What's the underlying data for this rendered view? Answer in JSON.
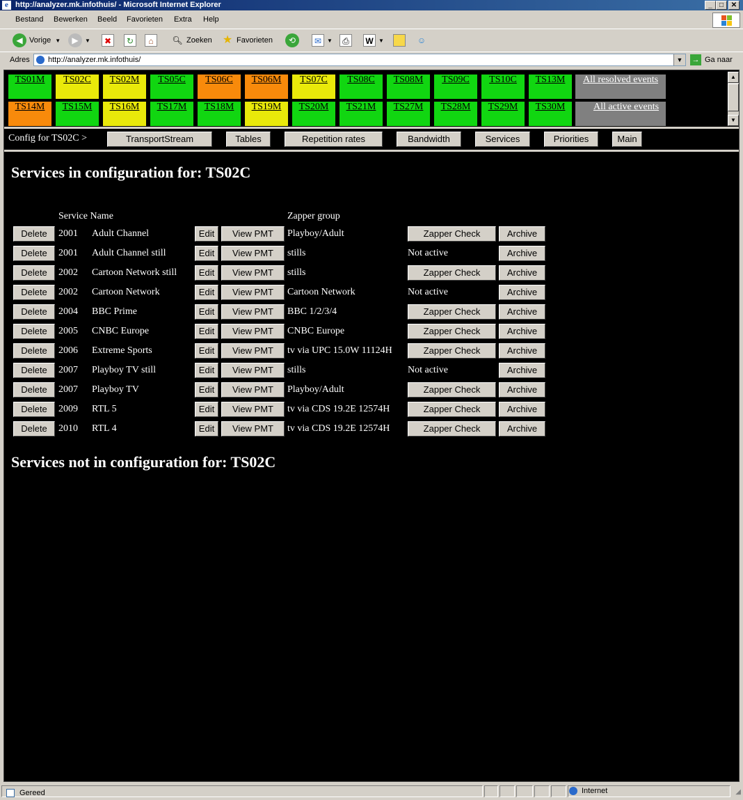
{
  "window": {
    "title": "http://analyzer.mk.infothuis/ - Microsoft Internet Explorer"
  },
  "menu": [
    "Bestand",
    "Bewerken",
    "Beeld",
    "Favorieten",
    "Extra",
    "Help"
  ],
  "toolbar": {
    "back": "Vorige",
    "search": "Zoeken",
    "favorites": "Favorieten"
  },
  "address": {
    "label": "Adres",
    "url": "http://analyzer.mk.infothuis/",
    "go": "Ga naar"
  },
  "ts_rows": [
    [
      {
        "label": "TS01M",
        "status": "green"
      },
      {
        "label": "TS02C",
        "status": "yellow"
      },
      {
        "label": "TS02M",
        "status": "yellow"
      },
      {
        "label": "TS05C",
        "status": "green"
      },
      {
        "label": "TS06C",
        "status": "orange"
      },
      {
        "label": "TS06M",
        "status": "orange"
      },
      {
        "label": "TS07C",
        "status": "yellow"
      },
      {
        "label": "TS08C",
        "status": "green"
      },
      {
        "label": "TS08M",
        "status": "green"
      },
      {
        "label": "TS09C",
        "status": "green"
      },
      {
        "label": "TS10C",
        "status": "green"
      },
      {
        "label": "TS13M",
        "status": "green"
      }
    ],
    [
      {
        "label": "TS14M",
        "status": "orange"
      },
      {
        "label": "TS15M",
        "status": "green"
      },
      {
        "label": "TS16M",
        "status": "yellow"
      },
      {
        "label": "TS17M",
        "status": "green"
      },
      {
        "label": "TS18M",
        "status": "green"
      },
      {
        "label": "TS19M",
        "status": "yellow"
      },
      {
        "label": "TS20M",
        "status": "green"
      },
      {
        "label": "TS21M",
        "status": "green"
      },
      {
        "label": "TS27M",
        "status": "green"
      },
      {
        "label": "TS28M",
        "status": "green"
      },
      {
        "label": "TS29M",
        "status": "green"
      },
      {
        "label": "TS30M",
        "status": "green"
      }
    ]
  ],
  "events": {
    "resolved": "All resolved events",
    "active": "All active events"
  },
  "config": {
    "label": "Config for TS02C >",
    "nav": [
      "TransportStream",
      "Tables",
      "Repetition rates",
      "Bandwidth",
      "Services",
      "Priorities",
      "Main"
    ]
  },
  "services": {
    "heading_in": "Services in configuration for: TS02C",
    "heading_out": "Services not in configuration for: TS02C",
    "col_service_name": "Service Name",
    "col_zapper_group": "Zapper group",
    "btn_delete": "Delete",
    "btn_edit": "Edit",
    "btn_viewpmt": "View PMT",
    "btn_zapper": "Zapper Check",
    "btn_archive": "Archive",
    "rows": [
      {
        "id": "2001",
        "name": "Adult Channel",
        "group": "Playboy/Adult",
        "zapper": "Zapper Check"
      },
      {
        "id": "2001",
        "name": "Adult Channel still",
        "group": "stills",
        "zapper": "Not active"
      },
      {
        "id": "2002",
        "name": "Cartoon Network still",
        "group": "stills",
        "zapper": "Zapper Check"
      },
      {
        "id": "2002",
        "name": "Cartoon Network",
        "group": "Cartoon Network",
        "zapper": "Not active"
      },
      {
        "id": "2004",
        "name": "BBC Prime",
        "group": "BBC 1/2/3/4",
        "zapper": "Zapper Check"
      },
      {
        "id": "2005",
        "name": "CNBC Europe",
        "group": "CNBC Europe",
        "zapper": "Zapper Check"
      },
      {
        "id": "2006",
        "name": "Extreme Sports",
        "group": "tv via UPC 15.0W 11124H",
        "zapper": "Zapper Check"
      },
      {
        "id": "2007",
        "name": "Playboy TV still",
        "group": "stills",
        "zapper": "Not active"
      },
      {
        "id": "2007",
        "name": "Playboy TV",
        "group": "Playboy/Adult",
        "zapper": "Zapper Check"
      },
      {
        "id": "2009",
        "name": "RTL 5",
        "group": "tv via CDS 19.2E 12574H",
        "zapper": "Zapper Check"
      },
      {
        "id": "2010",
        "name": "RTL 4",
        "group": "tv via CDS 19.2E 12574H",
        "zapper": "Zapper Check"
      }
    ]
  },
  "status": {
    "text": "Gereed",
    "zone": "Internet"
  },
  "colors": {
    "green": "#11d611",
    "yellow": "#e9e90a",
    "orange": "#f88a0b",
    "gray": "#808080"
  }
}
